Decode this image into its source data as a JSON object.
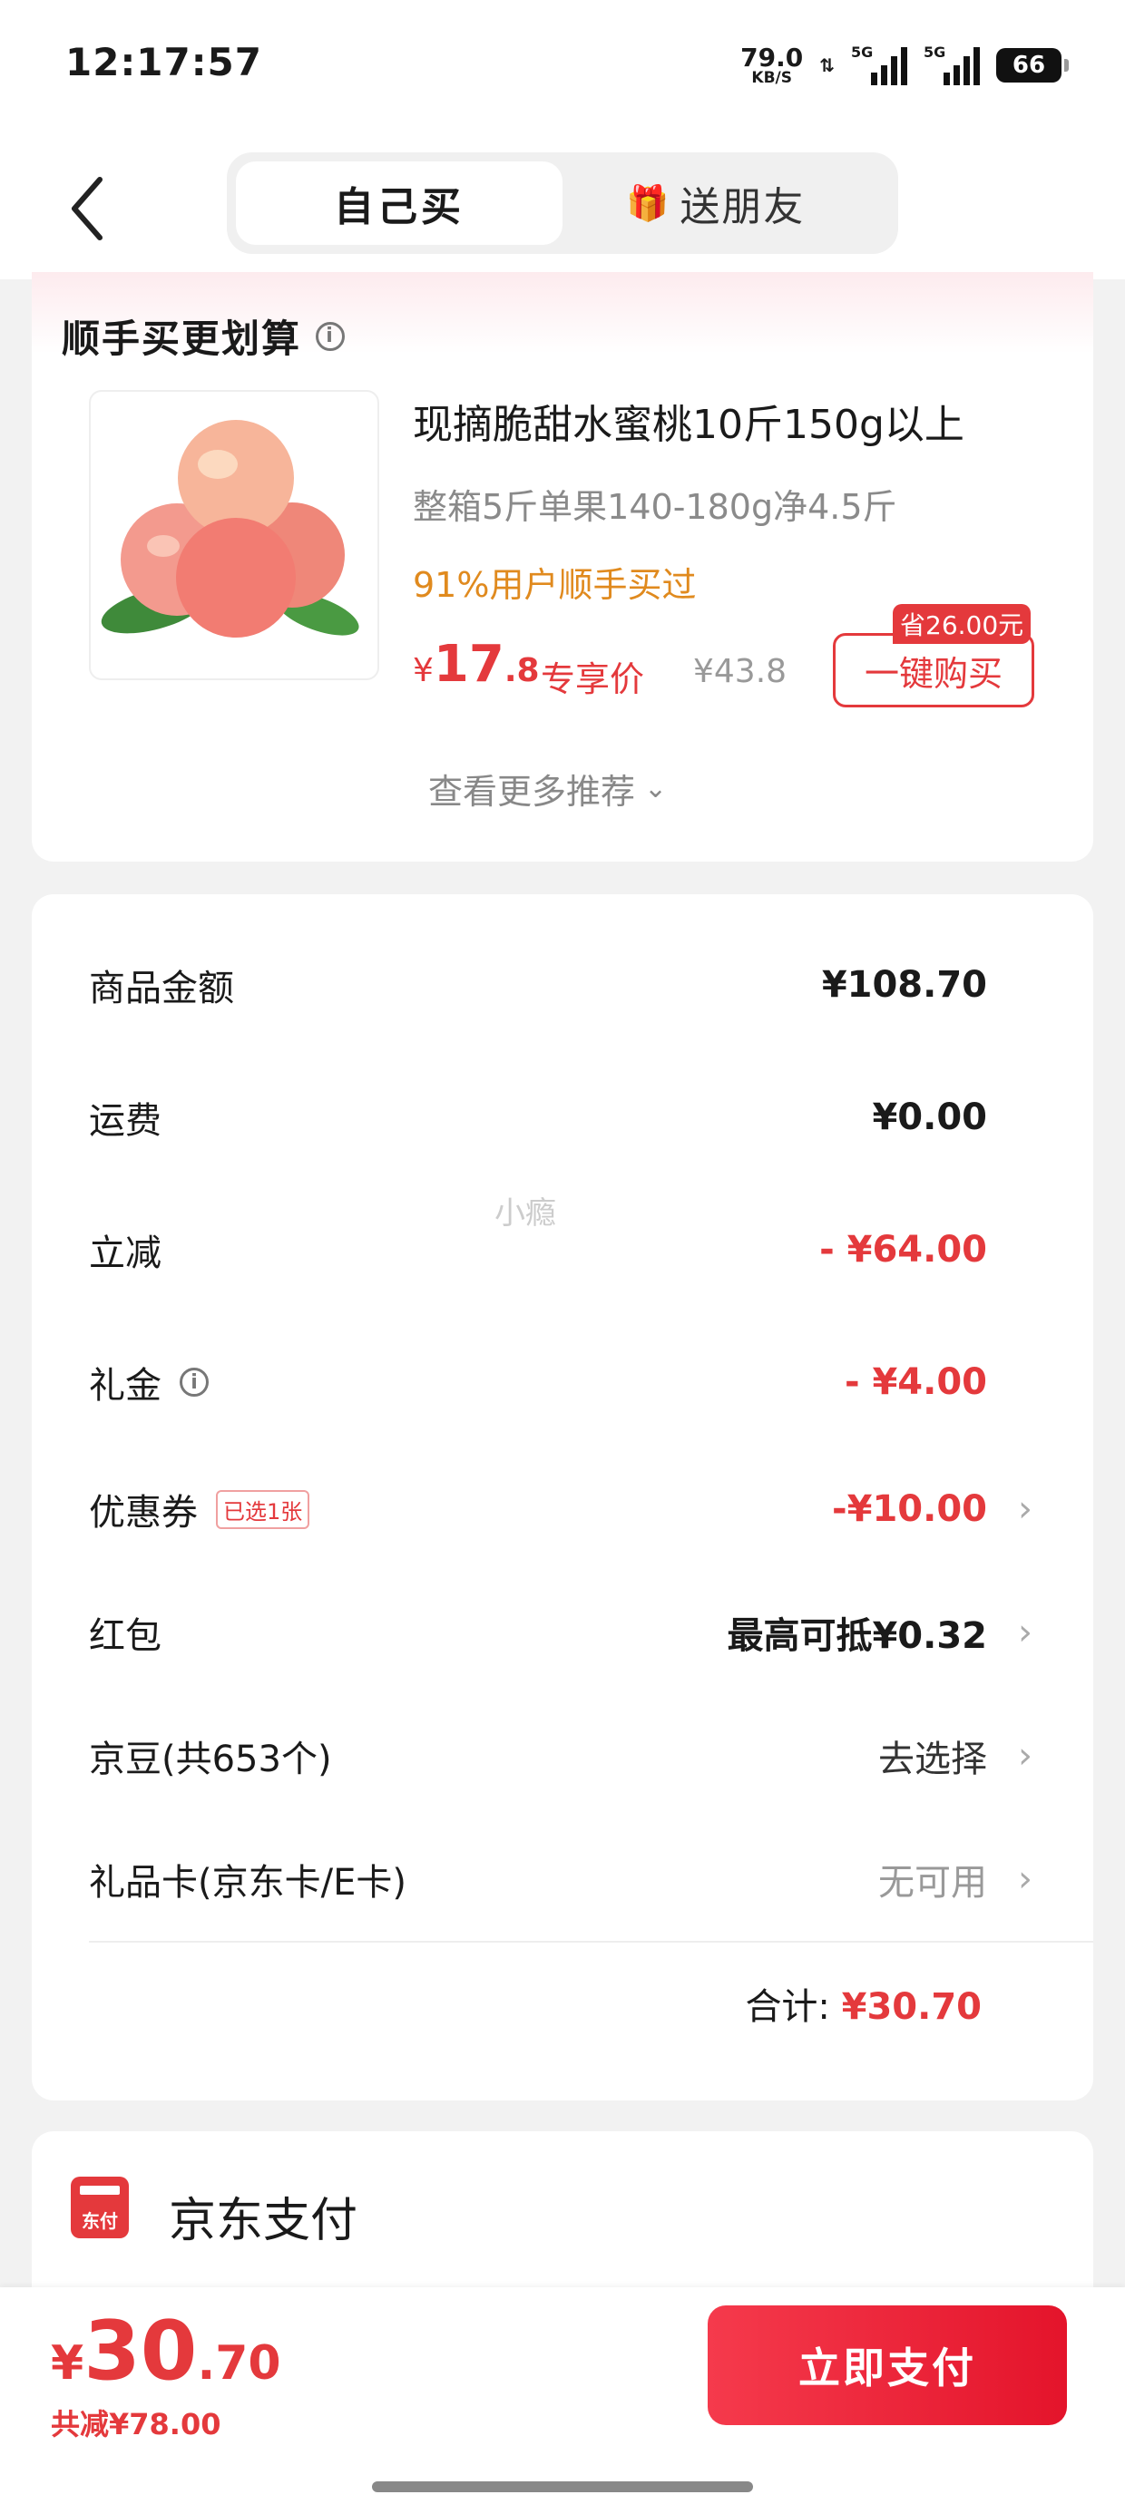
{
  "status_bar": {
    "time": "12:17:57",
    "net_speed": "79.0",
    "net_unit": "KB/S",
    "signal1_tag": "5G",
    "signal2_tag": "5G",
    "battery": "66"
  },
  "nav": {
    "tab_self": "自己买",
    "tab_gift": "送朋友"
  },
  "recommend": {
    "title": "顺手买更划算",
    "product_name": "现摘脆甜水蜜桃10斤150g以上",
    "product_spec": "整箱5斤单果140-180g净4.5斤",
    "social_proof": "91%用户顺手买过",
    "price_symbol": "¥",
    "price_int": "17",
    "price_dec": ".8",
    "price_label": "专享价",
    "original_price": "¥43.8",
    "save_tag": "省26.00元",
    "buy_button": "一键购买",
    "see_more": "查看更多推荐"
  },
  "summary": {
    "rows": [
      {
        "label": "商品金额",
        "value": "¥108.70"
      },
      {
        "label": "运费",
        "value": "¥0.00"
      },
      {
        "label": "立减",
        "value": "- ¥64.00"
      },
      {
        "label": "礼金",
        "value": "- ¥4.00"
      },
      {
        "label": "优惠券",
        "badge": "已选1张",
        "value": "-¥10.00"
      },
      {
        "label": "红包",
        "value": "最高可抵¥0.32"
      },
      {
        "label": "京豆(共653个)",
        "value": "去选择"
      },
      {
        "label": "礼品卡(京东卡/E卡)",
        "value": "无可用"
      }
    ],
    "total_label": "合计:",
    "total_value": "¥30.70",
    "watermark": "小瘾"
  },
  "payment": {
    "method": "京东支付",
    "icon_text": "东付"
  },
  "bottom_bar": {
    "price_symbol": "¥",
    "price_int": "30",
    "price_dec": ".70",
    "total_saved": "共减¥78.00",
    "pay_button": "立即支付"
  },
  "colors": {
    "accent": "#e4393c",
    "orange": "#e08a1e"
  }
}
